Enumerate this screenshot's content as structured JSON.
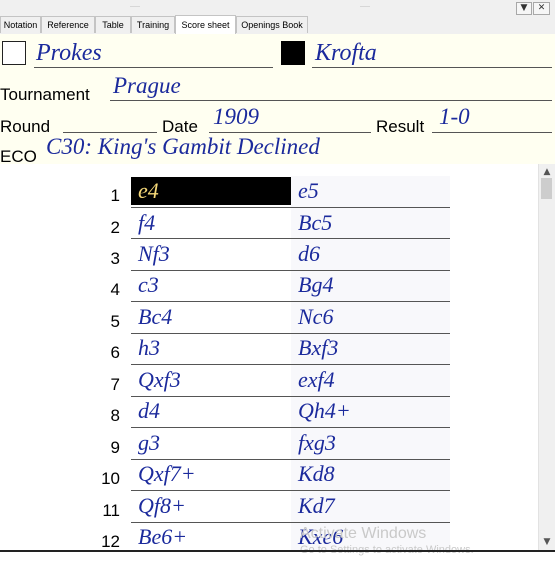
{
  "window": {
    "menu_button": "▼",
    "close_button": "✕"
  },
  "tabs": [
    {
      "label": "Notation",
      "active": false
    },
    {
      "label": "Reference",
      "active": false
    },
    {
      "label": "Table",
      "active": false
    },
    {
      "label": "Training",
      "active": false
    },
    {
      "label": "Score sheet",
      "active": true
    },
    {
      "label": "Openings Book",
      "active": false
    }
  ],
  "players": {
    "white": "Prokes",
    "black": "Krofta"
  },
  "fields": {
    "tournament_label": "Tournament",
    "tournament": "Prague",
    "round_label": "Round",
    "round": "",
    "date_label": "Date",
    "date": "1909",
    "result_label": "Result",
    "result": "1-0",
    "eco_label": "ECO",
    "eco": "C30: King's Gambit Declined"
  },
  "moves": [
    {
      "num": "1",
      "white": "e4",
      "black": "e5",
      "selected": "white"
    },
    {
      "num": "2",
      "white": "f4",
      "black": "Bc5"
    },
    {
      "num": "3",
      "white": "Nf3",
      "black": "d6"
    },
    {
      "num": "4",
      "white": "c3",
      "black": "Bg4"
    },
    {
      "num": "5",
      "white": "Bc4",
      "black": "Nc6"
    },
    {
      "num": "6",
      "white": "h3",
      "black": "Bxf3"
    },
    {
      "num": "7",
      "white": "Qxf3",
      "black": "exf4"
    },
    {
      "num": "8",
      "white": "d4",
      "black": "Qh4+"
    },
    {
      "num": "9",
      "white": "g3",
      "black": "fxg3"
    },
    {
      "num": "10",
      "white": "Qxf7+",
      "black": "Kd8"
    },
    {
      "num": "11",
      "white": "Qf8+",
      "black": "Kd7"
    },
    {
      "num": "12",
      "white": "Be6+",
      "black": "Kxe6"
    }
  ],
  "scrollbar": {
    "up_arrow": "▲",
    "down_arrow": "▼"
  },
  "watermark": {
    "line1": "Activate Windows",
    "line2": "Go to Settings to activate Windows."
  }
}
